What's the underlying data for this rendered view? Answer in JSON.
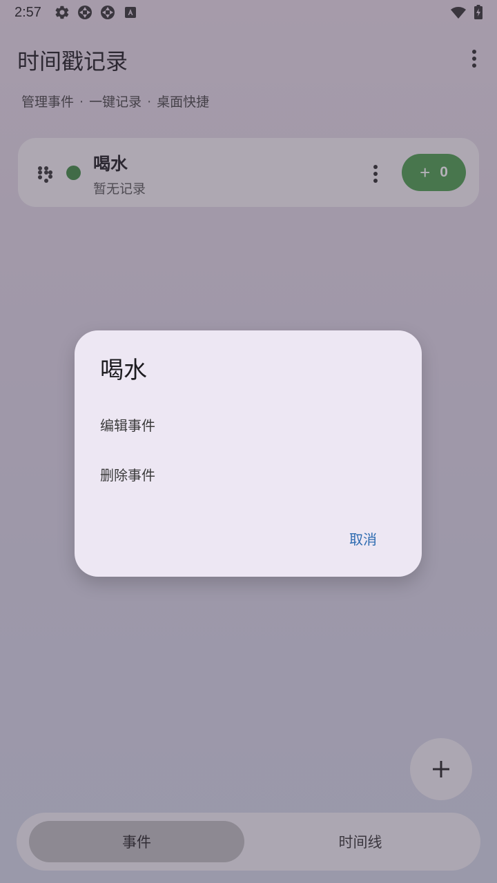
{
  "status_bar": {
    "time": "2:57",
    "icons": [
      "gear-icon",
      "aperture-icon",
      "aperture-icon",
      "text-icon",
      "wifi-icon",
      "battery-charging-icon"
    ]
  },
  "header": {
    "title": "时间戳记录",
    "subtitle_items": [
      "管理事件",
      "一键记录",
      "桌面快捷"
    ],
    "separator": "·"
  },
  "events": [
    {
      "name": "喝水",
      "subtitle": "暂无记录",
      "color": "#3e8a42",
      "button_plus": "+",
      "button_count": "0"
    }
  ],
  "fab": {
    "label": "+"
  },
  "bottom_nav": {
    "tabs": [
      {
        "label": "事件",
        "selected": true
      },
      {
        "label": "时间线",
        "selected": false
      }
    ]
  },
  "dialog": {
    "title": "喝水",
    "items": [
      "编辑事件",
      "删除事件"
    ],
    "cancel": "取消"
  },
  "colors": {
    "accent": "#2d6bb0",
    "event_green": "#4a9d4c"
  }
}
